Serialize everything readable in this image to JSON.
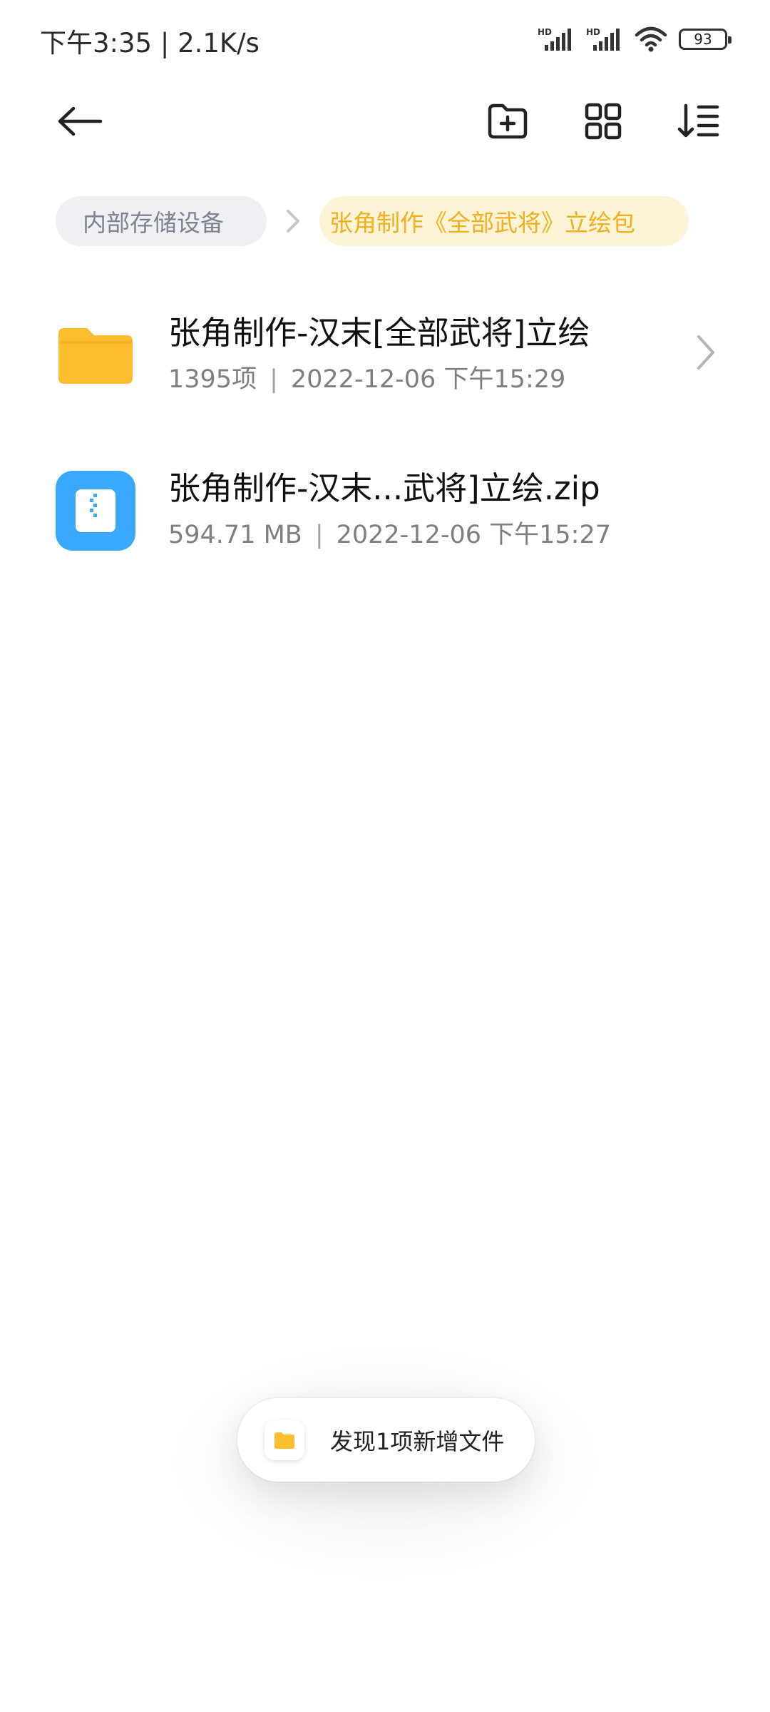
{
  "status_bar": {
    "time_speed": "下午3:35 | 2.1K/s",
    "signal1_label": "HD",
    "signal2_label": "HD",
    "battery": "93",
    "icons": [
      "hd-signal-icon",
      "hd-signal-icon",
      "wifi-icon",
      "battery-icon"
    ]
  },
  "toolbar": {
    "back_icon": "back-arrow-icon",
    "new_folder_icon": "new-folder-icon",
    "grid_view_icon": "grid-view-icon",
    "sort_icon": "sort-icon"
  },
  "breadcrumb": {
    "root": "内部存储设备",
    "current": "张角制作《全部武将》立绘包"
  },
  "files": [
    {
      "name": "张角制作-汉末[全部武将]立绘",
      "count": "1395项",
      "date": "2022-12-06 下午15:29",
      "icon": "folder-icon"
    },
    {
      "name": "张角制作-汉末...武将]立绘.zip",
      "size": "594.71 MB",
      "date": "2022-12-06 下午15:27",
      "icon": "zip-file-icon"
    }
  ],
  "toast": {
    "text": "发现1项新增文件",
    "icon": "folder-icon"
  },
  "colors": {
    "accent": "#f2b01f",
    "folder": "#fdbf2d",
    "zip": "#3aa8fb",
    "crumb_root_bg": "#eef0f3",
    "crumb_current_bg": "#fdf3d6"
  }
}
